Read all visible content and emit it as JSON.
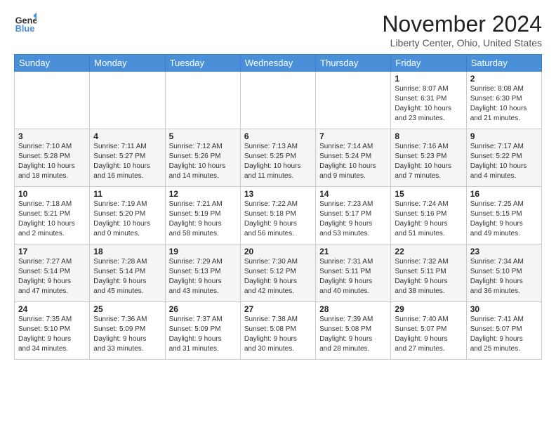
{
  "logo": {
    "line1": "General",
    "line2": "Blue"
  },
  "header": {
    "month": "November 2024",
    "location": "Liberty Center, Ohio, United States"
  },
  "weekdays": [
    "Sunday",
    "Monday",
    "Tuesday",
    "Wednesday",
    "Thursday",
    "Friday",
    "Saturday"
  ],
  "weeks": [
    [
      {
        "day": "",
        "info": ""
      },
      {
        "day": "",
        "info": ""
      },
      {
        "day": "",
        "info": ""
      },
      {
        "day": "",
        "info": ""
      },
      {
        "day": "",
        "info": ""
      },
      {
        "day": "1",
        "info": "Sunrise: 8:07 AM\nSunset: 6:31 PM\nDaylight: 10 hours\nand 23 minutes."
      },
      {
        "day": "2",
        "info": "Sunrise: 8:08 AM\nSunset: 6:30 PM\nDaylight: 10 hours\nand 21 minutes."
      }
    ],
    [
      {
        "day": "3",
        "info": "Sunrise: 7:10 AM\nSunset: 5:28 PM\nDaylight: 10 hours\nand 18 minutes."
      },
      {
        "day": "4",
        "info": "Sunrise: 7:11 AM\nSunset: 5:27 PM\nDaylight: 10 hours\nand 16 minutes."
      },
      {
        "day": "5",
        "info": "Sunrise: 7:12 AM\nSunset: 5:26 PM\nDaylight: 10 hours\nand 14 minutes."
      },
      {
        "day": "6",
        "info": "Sunrise: 7:13 AM\nSunset: 5:25 PM\nDaylight: 10 hours\nand 11 minutes."
      },
      {
        "day": "7",
        "info": "Sunrise: 7:14 AM\nSunset: 5:24 PM\nDaylight: 10 hours\nand 9 minutes."
      },
      {
        "day": "8",
        "info": "Sunrise: 7:16 AM\nSunset: 5:23 PM\nDaylight: 10 hours\nand 7 minutes."
      },
      {
        "day": "9",
        "info": "Sunrise: 7:17 AM\nSunset: 5:22 PM\nDaylight: 10 hours\nand 4 minutes."
      }
    ],
    [
      {
        "day": "10",
        "info": "Sunrise: 7:18 AM\nSunset: 5:21 PM\nDaylight: 10 hours\nand 2 minutes."
      },
      {
        "day": "11",
        "info": "Sunrise: 7:19 AM\nSunset: 5:20 PM\nDaylight: 10 hours\nand 0 minutes."
      },
      {
        "day": "12",
        "info": "Sunrise: 7:21 AM\nSunset: 5:19 PM\nDaylight: 9 hours\nand 58 minutes."
      },
      {
        "day": "13",
        "info": "Sunrise: 7:22 AM\nSunset: 5:18 PM\nDaylight: 9 hours\nand 56 minutes."
      },
      {
        "day": "14",
        "info": "Sunrise: 7:23 AM\nSunset: 5:17 PM\nDaylight: 9 hours\nand 53 minutes."
      },
      {
        "day": "15",
        "info": "Sunrise: 7:24 AM\nSunset: 5:16 PM\nDaylight: 9 hours\nand 51 minutes."
      },
      {
        "day": "16",
        "info": "Sunrise: 7:25 AM\nSunset: 5:15 PM\nDaylight: 9 hours\nand 49 minutes."
      }
    ],
    [
      {
        "day": "17",
        "info": "Sunrise: 7:27 AM\nSunset: 5:14 PM\nDaylight: 9 hours\nand 47 minutes."
      },
      {
        "day": "18",
        "info": "Sunrise: 7:28 AM\nSunset: 5:14 PM\nDaylight: 9 hours\nand 45 minutes."
      },
      {
        "day": "19",
        "info": "Sunrise: 7:29 AM\nSunset: 5:13 PM\nDaylight: 9 hours\nand 43 minutes."
      },
      {
        "day": "20",
        "info": "Sunrise: 7:30 AM\nSunset: 5:12 PM\nDaylight: 9 hours\nand 42 minutes."
      },
      {
        "day": "21",
        "info": "Sunrise: 7:31 AM\nSunset: 5:11 PM\nDaylight: 9 hours\nand 40 minutes."
      },
      {
        "day": "22",
        "info": "Sunrise: 7:32 AM\nSunset: 5:11 PM\nDaylight: 9 hours\nand 38 minutes."
      },
      {
        "day": "23",
        "info": "Sunrise: 7:34 AM\nSunset: 5:10 PM\nDaylight: 9 hours\nand 36 minutes."
      }
    ],
    [
      {
        "day": "24",
        "info": "Sunrise: 7:35 AM\nSunset: 5:10 PM\nDaylight: 9 hours\nand 34 minutes."
      },
      {
        "day": "25",
        "info": "Sunrise: 7:36 AM\nSunset: 5:09 PM\nDaylight: 9 hours\nand 33 minutes."
      },
      {
        "day": "26",
        "info": "Sunrise: 7:37 AM\nSunset: 5:09 PM\nDaylight: 9 hours\nand 31 minutes."
      },
      {
        "day": "27",
        "info": "Sunrise: 7:38 AM\nSunset: 5:08 PM\nDaylight: 9 hours\nand 30 minutes."
      },
      {
        "day": "28",
        "info": "Sunrise: 7:39 AM\nSunset: 5:08 PM\nDaylight: 9 hours\nand 28 minutes."
      },
      {
        "day": "29",
        "info": "Sunrise: 7:40 AM\nSunset: 5:07 PM\nDaylight: 9 hours\nand 27 minutes."
      },
      {
        "day": "30",
        "info": "Sunrise: 7:41 AM\nSunset: 5:07 PM\nDaylight: 9 hours\nand 25 minutes."
      }
    ]
  ]
}
